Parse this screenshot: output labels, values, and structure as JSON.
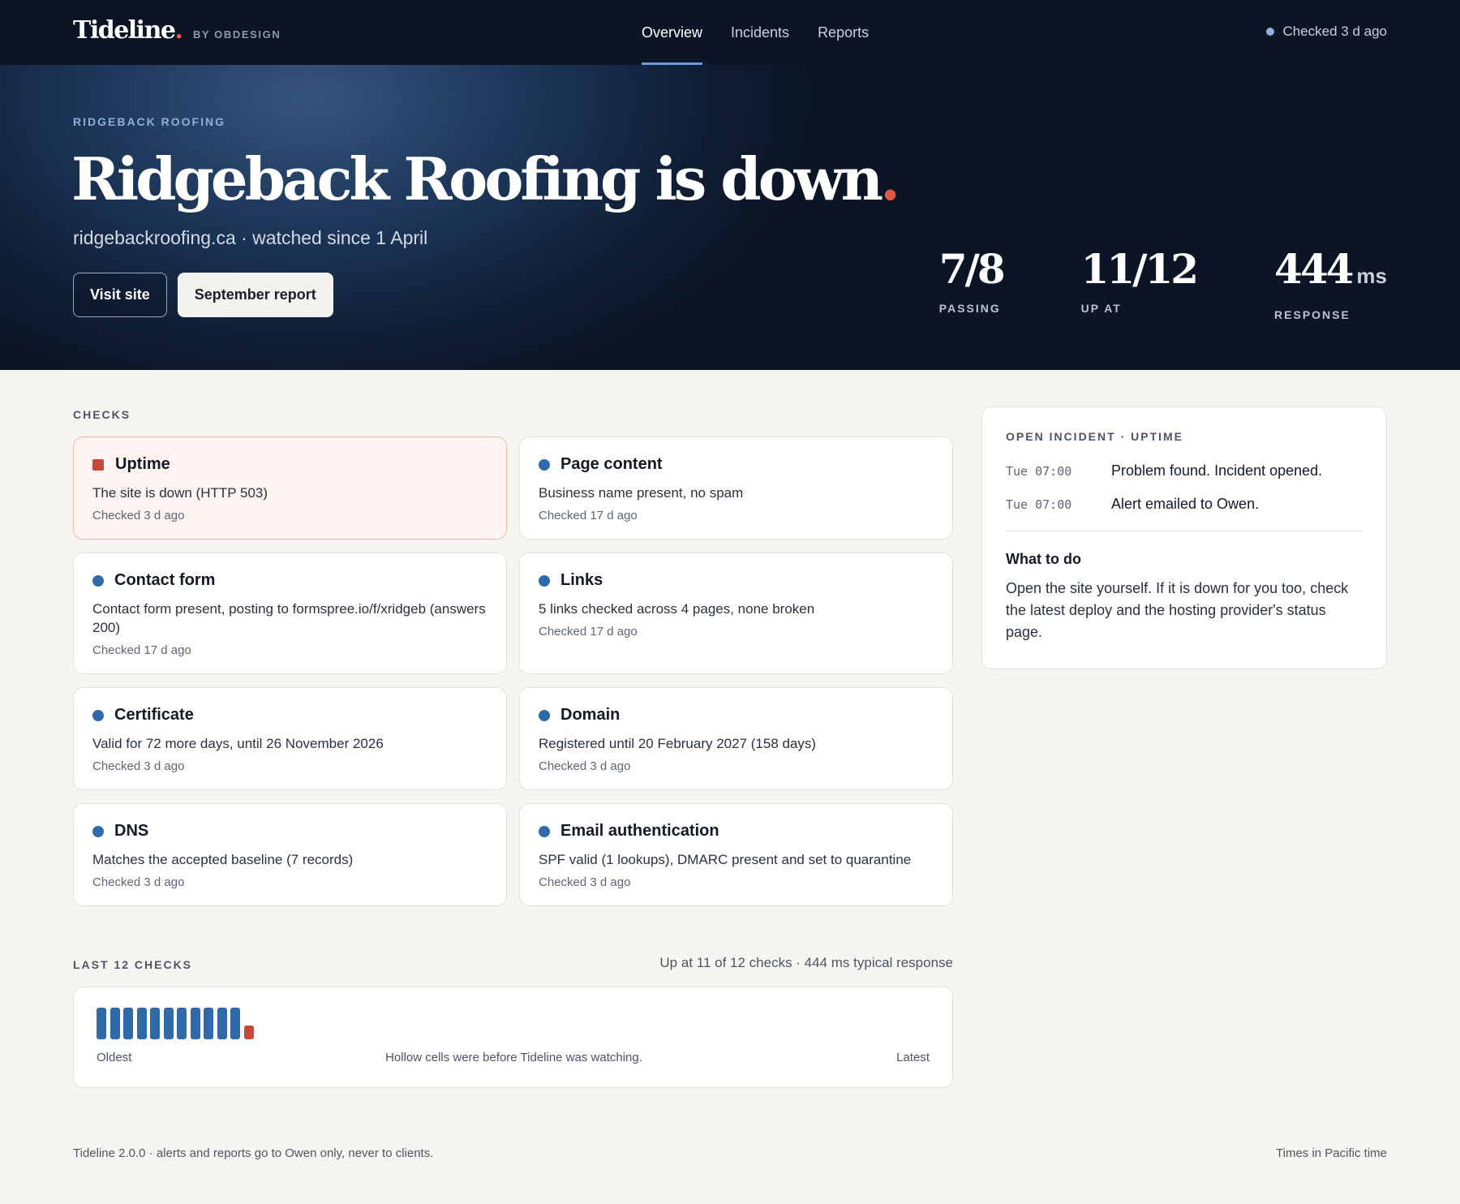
{
  "header": {
    "brand_name": "Tideline",
    "brand_dot": ".",
    "brand_by": "BY OBDESIGN",
    "nav": [
      {
        "label": "Overview",
        "active": true
      },
      {
        "label": "Incidents",
        "active": false
      },
      {
        "label": "Reports",
        "active": false
      }
    ],
    "status_text": "Checked 3 d ago"
  },
  "hero": {
    "eyebrow": "RIDGEBACK ROOFING",
    "title": "Ridgeback Roofing is down",
    "title_dot": ".",
    "subtitle": "ridgebackroofing.ca · watched since 1 April",
    "visit_button": "Visit site",
    "report_button": "September report",
    "stats": [
      {
        "value": "7/8",
        "unit": "",
        "label": "PASSING"
      },
      {
        "value": "11/12",
        "unit": "",
        "label": "UP AT"
      },
      {
        "value": "444",
        "unit": "ms",
        "label": "RESPONSE"
      }
    ]
  },
  "checks": {
    "section_label": "CHECKS",
    "items": [
      {
        "title": "Uptime",
        "status": "fail",
        "detail": "The site is down (HTTP 503)",
        "checked": "Checked 3 d ago"
      },
      {
        "title": "Page content",
        "status": "ok",
        "detail": "Business name present, no spam",
        "checked": "Checked 17 d ago"
      },
      {
        "title": "Contact form",
        "status": "ok",
        "detail": "Contact form present, posting to formspree.io/f/xridgeb (answers 200)",
        "checked": "Checked 17 d ago"
      },
      {
        "title": "Links",
        "status": "ok",
        "detail": "5 links checked across 4 pages, none broken",
        "checked": "Checked 17 d ago"
      },
      {
        "title": "Certificate",
        "status": "ok",
        "detail": "Valid for 72 more days, until 26 November 2026",
        "checked": "Checked 3 d ago"
      },
      {
        "title": "Domain",
        "status": "ok",
        "detail": "Registered until 20 February 2027 (158 days)",
        "checked": "Checked 3 d ago"
      },
      {
        "title": "DNS",
        "status": "ok",
        "detail": "Matches the accepted baseline (7 records)",
        "checked": "Checked 3 d ago"
      },
      {
        "title": "Email authentication",
        "status": "ok",
        "detail": "SPF valid (1 lookups), DMARC present and set to quarantine",
        "checked": "Checked 3 d ago"
      }
    ]
  },
  "history": {
    "section_label": "LAST 12 CHECKS",
    "summary": "Up at 11 of 12 checks · 444 ms typical response",
    "results": [
      "up",
      "up",
      "up",
      "up",
      "up",
      "up",
      "up",
      "up",
      "up",
      "up",
      "up",
      "down"
    ],
    "oldest_label": "Oldest",
    "note": "Hollow cells were before Tideline was watching.",
    "latest_label": "Latest"
  },
  "incident": {
    "label": "OPEN INCIDENT · UPTIME",
    "events": [
      {
        "time": "Tue 07:00",
        "text": "Problem found. Incident opened."
      },
      {
        "time": "Tue 07:00",
        "text": "Alert emailed to Owen."
      }
    ],
    "todo_title": "What to do",
    "todo_body": "Open the site yourself. If it is down for you too, check the latest deploy and the hosting provider's status page."
  },
  "footer": {
    "left": "Tideline 2.0.0 · alerts and reports go to Owen only, never to clients.",
    "right": "Times in Pacific time"
  },
  "colors": {
    "accent": "#2f6ba8",
    "alert": "#c4493a",
    "header_bg": "#0b1526"
  }
}
